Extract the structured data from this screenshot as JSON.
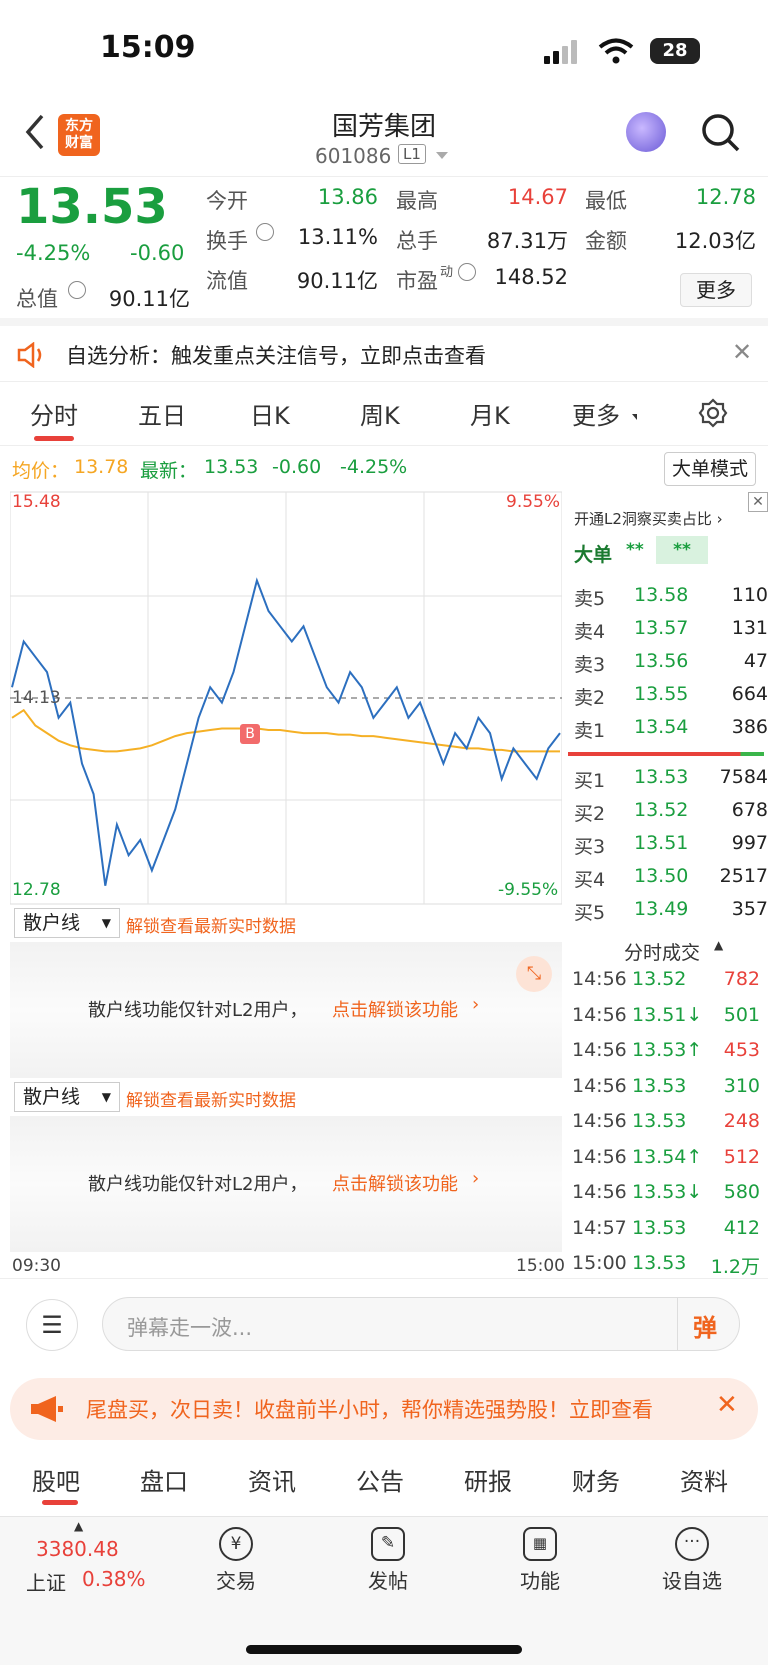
{
  "status": {
    "time": "15:09",
    "battery": "28"
  },
  "nav": {
    "logo": "东方\n财富",
    "name": "国芳集团",
    "code": "601086",
    "level": "L1"
  },
  "quote": {
    "price": "13.53",
    "pct": "-4.25%",
    "chg": "-0.60",
    "open_l": "今开",
    "open": "13.86",
    "high_l": "最高",
    "high": "14.67",
    "low_l": "最低",
    "low": "12.78",
    "turn_l": "换手",
    "turn": "13.11%",
    "vol_l": "总手",
    "vol": "87.31万",
    "amt_l": "金额",
    "amt": "12.03亿",
    "mcap_l": "总值",
    "mcap": "90.11亿",
    "float_l": "流值",
    "float": "90.11亿",
    "pe_l": "市盈",
    "pe_sup": "动",
    "pe": "148.52",
    "more": "更多"
  },
  "banner": {
    "text": "自选分析：触发重点关注信号，立即点击查看"
  },
  "tabs": [
    "分时",
    "五日",
    "日K",
    "周K",
    "月K",
    "更多"
  ],
  "info": {
    "avg_l": "均价：",
    "avg": "13.78",
    "last_l": "最新：",
    "last": "13.53",
    "chg": "-0.60",
    "pct": "-4.25%",
    "big_mode": "大单模式"
  },
  "chart_data": {
    "type": "line",
    "y_top": "15.48",
    "y_bottom": "12.78",
    "pct_top": "9.55%",
    "pct_bottom": "-9.55%",
    "prev_close": "14.13",
    "x_start": "09:30",
    "x_end": "15:00",
    "marker": "B",
    "series": [
      {
        "name": "最新",
        "values": [
          14.2,
          14.5,
          14.4,
          14.3,
          14.0,
          14.1,
          13.7,
          13.5,
          12.9,
          13.3,
          13.1,
          13.2,
          13.0,
          13.2,
          13.4,
          13.7,
          14.0,
          14.2,
          14.1,
          14.3,
          14.6,
          14.9,
          14.7,
          14.6,
          14.5,
          14.6,
          14.4,
          14.2,
          14.1,
          14.3,
          14.2,
          14.0,
          14.1,
          14.2,
          14.0,
          14.1,
          13.9,
          13.7,
          13.9,
          13.8,
          14.0,
          13.9,
          13.6,
          13.8,
          13.7,
          13.6,
          13.8,
          13.9
        ]
      },
      {
        "name": "均价",
        "values": [
          14.0,
          14.05,
          13.95,
          13.9,
          13.85,
          13.82,
          13.8,
          13.79,
          13.78,
          13.78,
          13.79,
          13.8,
          13.82,
          13.85,
          13.88,
          13.9,
          13.91,
          13.92,
          13.93,
          13.93,
          13.93,
          13.93,
          13.92,
          13.92,
          13.91,
          13.9,
          13.9,
          13.9,
          13.89,
          13.89,
          13.88,
          13.88,
          13.87,
          13.86,
          13.85,
          13.84,
          13.83,
          13.82,
          13.81,
          13.8,
          13.8,
          13.79,
          13.79,
          13.78,
          13.78,
          13.78,
          13.78,
          13.78
        ]
      }
    ]
  },
  "sub": {
    "dropdown": "散户线",
    "unlock": "解锁查看最新实时数据",
    "msg": "散户线功能仅针对L2用户，",
    "link": "点击解锁该功能"
  },
  "orderbook": {
    "l2_tip": "开通L2洞察买卖占比",
    "big_l": "大单",
    "big_v1": "**",
    "big_v2": "**",
    "sell": [
      {
        "l": "卖5",
        "p": "13.58",
        "v": "110"
      },
      {
        "l": "卖4",
        "p": "13.57",
        "v": "131"
      },
      {
        "l": "卖3",
        "p": "13.56",
        "v": "47"
      },
      {
        "l": "卖2",
        "p": "13.55",
        "v": "664"
      },
      {
        "l": "卖1",
        "p": "13.54",
        "v": "386"
      }
    ],
    "buy": [
      {
        "l": "买1",
        "p": "13.53",
        "v": "7584"
      },
      {
        "l": "买2",
        "p": "13.52",
        "v": "678"
      },
      {
        "l": "买3",
        "p": "13.51",
        "v": "997"
      },
      {
        "l": "买4",
        "p": "13.50",
        "v": "2517"
      },
      {
        "l": "买5",
        "p": "13.49",
        "v": "357"
      }
    ],
    "ticks_title": "分时成交",
    "ticks": [
      {
        "t": "14:56",
        "p": "13.52",
        "v": "782",
        "c": "red"
      },
      {
        "t": "14:56",
        "p": "13.51↓",
        "v": "501",
        "c": "green"
      },
      {
        "t": "14:56",
        "p": "13.53↑",
        "v": "453",
        "c": "red"
      },
      {
        "t": "14:56",
        "p": "13.53",
        "v": "310",
        "c": "green"
      },
      {
        "t": "14:56",
        "p": "13.53",
        "v": "248",
        "c": "red"
      },
      {
        "t": "14:56",
        "p": "13.54↑",
        "v": "512",
        "c": "red"
      },
      {
        "t": "14:56",
        "p": "13.53↓",
        "v": "580",
        "c": "green"
      },
      {
        "t": "14:57",
        "p": "13.53",
        "v": "412",
        "c": "green"
      },
      {
        "t": "15:00",
        "p": "13.53",
        "v": "1.2万",
        "c": "green"
      }
    ]
  },
  "danmu": {
    "placeholder": "弹幕走一波...",
    "btn": "弹"
  },
  "ad": {
    "text": "尾盘买，次日卖！收盘前半小时，帮你精选强势股！立即查看"
  },
  "btabs": [
    "股吧",
    "盘口",
    "资讯",
    "公告",
    "研报",
    "财务",
    "资料"
  ],
  "bottom": {
    "index_val": "3380.48",
    "index_name": "上证",
    "index_pct": "0.38%",
    "items": [
      "交易",
      "发帖",
      "功能",
      "设自选"
    ]
  }
}
